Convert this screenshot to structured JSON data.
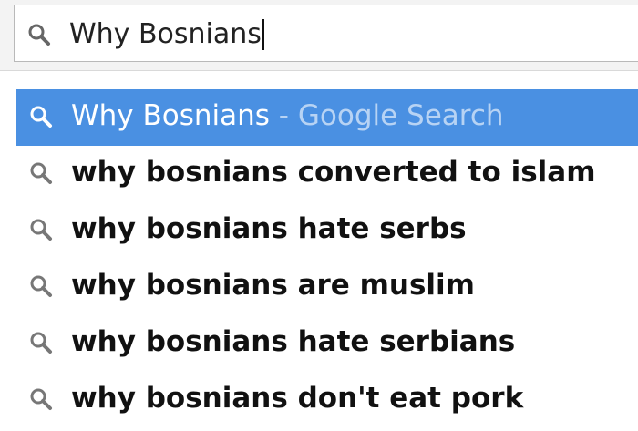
{
  "omnibox": {
    "value": "Why Bosnians"
  },
  "dropdown": {
    "selected": {
      "query": "Why Bosnians",
      "separator": " - ",
      "engine": "Google Search"
    },
    "suggestions": [
      {
        "label": "why bosnians converted to islam"
      },
      {
        "label": "why bosnians hate serbs"
      },
      {
        "label": "why bosnians are muslim"
      },
      {
        "label": "why bosnians hate serbians"
      },
      {
        "label": "why bosnians don't eat pork"
      }
    ]
  },
  "colors": {
    "selected_background": "#4a90e2",
    "selected_text": "#ffffff",
    "selected_engine_text": "#b7d3f4",
    "icon_gray": "#777777"
  },
  "icons": {
    "omnibox": "search-icon",
    "suggestion": "search-icon"
  }
}
